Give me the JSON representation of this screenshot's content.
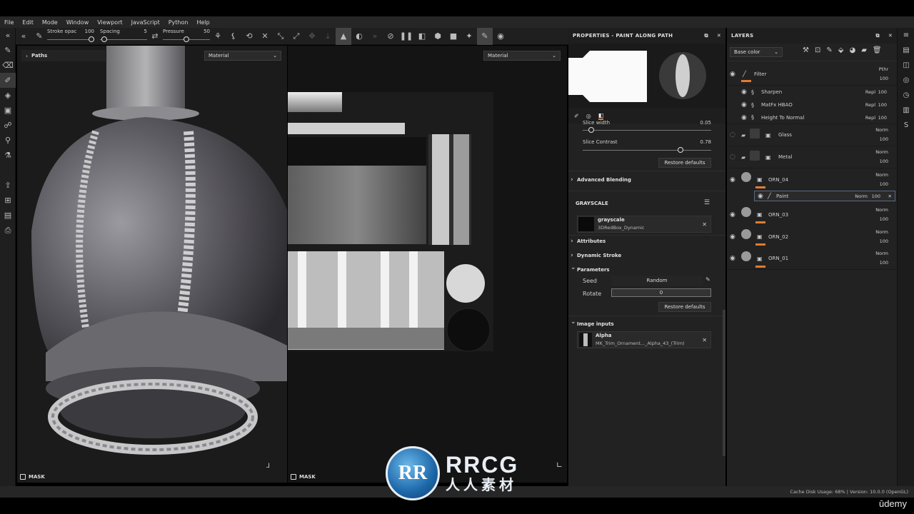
{
  "menu": [
    "File",
    "Edit",
    "Mode",
    "Window",
    "Viewport",
    "JavaScript",
    "Python",
    "Help"
  ],
  "toolbar": {
    "stroke_opacity_label": "Stroke opac",
    "stroke_opacity_value": "100",
    "spacing_label": "Spacing",
    "spacing_value": "5",
    "pressure_label": "Pressure",
    "pressure_value": "50"
  },
  "viewport3d": {
    "paths_label": "Paths",
    "material_select": "Material",
    "mask_label": "MASK"
  },
  "viewport2d": {
    "material_select": "Material",
    "mask_label": "MASK"
  },
  "properties": {
    "title": "PROPERTIES - PAINT ALONG PATH",
    "slice_width_label": "Slice width",
    "slice_width_value": "0.05",
    "slice_contrast_label": "Slice Contrast",
    "slice_contrast_value": "0.78",
    "restore_defaults": "Restore defaults",
    "advanced_blending": "Advanced Blending",
    "grayscale_header": "GRAYSCALE",
    "grayscale_name": "grayscale",
    "grayscale_source": "3DRedBox_Dynamic",
    "attributes": "Attributes",
    "dynamic_stroke": "Dynamic Stroke",
    "parameters": "Parameters",
    "seed_label": "Seed",
    "seed_value": "Random",
    "rotate_label": "Rotate",
    "rotate_value": "0",
    "restore_defaults_2": "Restore defaults",
    "image_inputs": "Image inputs",
    "alpha_name": "Alpha",
    "alpha_source": "MK_Trim_Ornament..._Alpha_43_(Trim)"
  },
  "layers": {
    "title": "LAYERS",
    "channel_select": "Base color",
    "rows": [
      {
        "name": "Filter",
        "blend": "Pthr",
        "opacity": "100"
      },
      {
        "name": "Sharpen",
        "blend": "Repl",
        "opacity": "100"
      },
      {
        "name": "MatFx HBAO",
        "blend": "Repl",
        "opacity": "100"
      },
      {
        "name": "Height To Normal",
        "blend": "Repl",
        "opacity": "100"
      },
      {
        "name": "Glass",
        "blend": "Norm",
        "opacity": "100"
      },
      {
        "name": "Metal",
        "blend": "Norm",
        "opacity": "100"
      },
      {
        "name": "ORN_04",
        "blend": "Norm",
        "opacity": "100"
      },
      {
        "name": "Paint",
        "blend": "Norm",
        "opacity": "100"
      },
      {
        "name": "ORN_03",
        "blend": "Norm",
        "opacity": "100"
      },
      {
        "name": "ORN_02",
        "blend": "Norm",
        "opacity": "100"
      },
      {
        "name": "ORN_01",
        "blend": "Norm",
        "opacity": "100"
      }
    ]
  },
  "status": {
    "text": "Cache Disk Usage:   68% | Version: 10.0.0 (OpenGL)"
  },
  "watermark": {
    "mark": "RR",
    "line1": "RRCG",
    "line2": "人人素材"
  },
  "brand": "ūdemy",
  "accent_color": "#e07b32"
}
